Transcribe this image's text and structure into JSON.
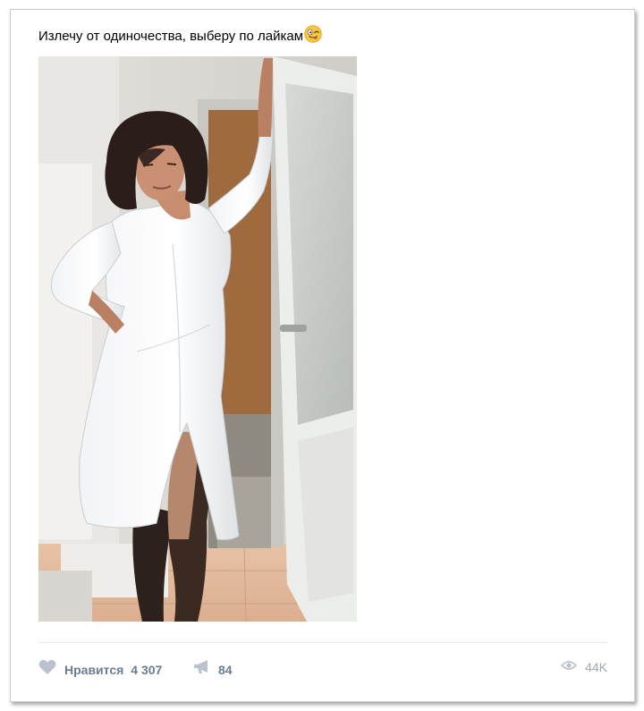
{
  "post": {
    "text": "Излечу от одиночества, выберу по лайкам",
    "emoji": "winking-face-with-tongue-icon"
  },
  "actions": {
    "like_label": "Нравится",
    "like_count": "4 307",
    "share_count": "84",
    "views_count": "44K"
  },
  "colors": {
    "action_text": "#6a7d91",
    "muted": "#a0a7b0",
    "icon": "#b9c2cd",
    "border": "#c9ccd1"
  }
}
